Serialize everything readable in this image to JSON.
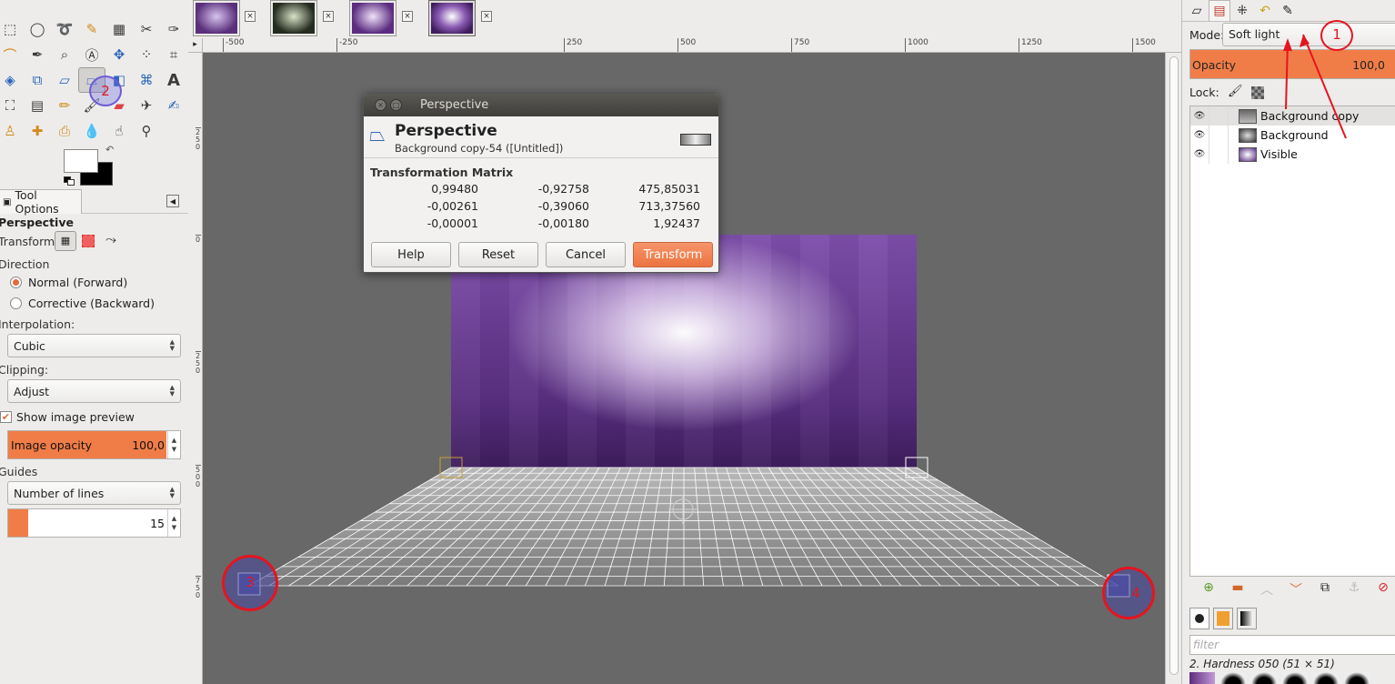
{
  "toolbox": {
    "tab_label": "Tool Options",
    "tool_name": "Perspective",
    "transform_label": "Transform:",
    "direction_label": "Direction",
    "direction_options": [
      "Normal (Forward)",
      "Corrective (Backward)"
    ],
    "direction_selected": "Normal (Forward)",
    "interpolation_label": "Interpolation:",
    "interpolation_value": "Cubic",
    "clipping_label": "Clipping:",
    "clipping_value": "Adjust",
    "show_preview_label": "Show image preview",
    "show_preview_checked": true,
    "image_opacity_label": "Image opacity",
    "image_opacity_value": "100,0",
    "guides_label": "Guides",
    "guides_value": "Number of lines",
    "lines_value": "15",
    "fg_color": "#ffffff",
    "bg_color": "#000000"
  },
  "ruler_h": [
    "-500",
    "-250",
    "250",
    "500",
    "750",
    "1000",
    "1250",
    "1500"
  ],
  "ruler_v": [
    "2 5 0",
    "0",
    "2 5 0",
    "5 0 0",
    "7 5 0"
  ],
  "dialog": {
    "window_title": "Perspective",
    "heading": "Perspective",
    "subheading": "Background copy-54 ([Untitled])",
    "section": "Transformation Matrix",
    "matrix": [
      [
        "0,99480",
        "-0,92758",
        "475,85031"
      ],
      [
        "-0,00261",
        "-0,39060",
        "713,37560"
      ],
      [
        "-0,00001",
        "-0,00180",
        "1,92437"
      ]
    ],
    "buttons": {
      "help": "Help",
      "reset": "Reset",
      "cancel": "Cancel",
      "transform": "Transform"
    }
  },
  "dock": {
    "mode_label": "Mode:",
    "mode_value": "Soft light",
    "opacity_label": "Opacity",
    "opacity_value": "100,0",
    "lock_label": "Lock:",
    "layers": [
      "Background copy",
      "Background",
      "Visible"
    ],
    "selected_layer": "Background copy",
    "filter_placeholder": "filter",
    "brush_name": "2. Hardness 050 (51 × 51)"
  },
  "annotations": [
    "1",
    "2",
    "3",
    "4"
  ],
  "colors": {
    "accent": "#f07d47",
    "annotation": "#e5141f",
    "canvas_bg": "#686868"
  }
}
